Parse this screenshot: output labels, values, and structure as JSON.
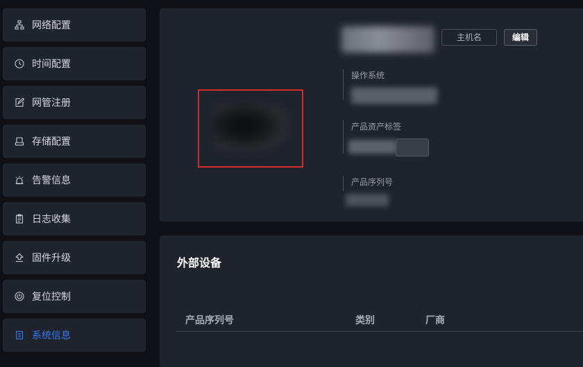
{
  "sidebar": {
    "items": [
      {
        "label": "网络配置",
        "icon": "network-icon",
        "active": false
      },
      {
        "label": "时间配置",
        "icon": "clock-icon",
        "active": false
      },
      {
        "label": "网管注册",
        "icon": "edit-icon",
        "active": false
      },
      {
        "label": "存储配置",
        "icon": "storage-icon",
        "active": false
      },
      {
        "label": "告警信息",
        "icon": "alarm-icon",
        "active": false
      },
      {
        "label": "日志收集",
        "icon": "clipboard-icon",
        "active": false
      },
      {
        "label": "固件升级",
        "icon": "upload-icon",
        "active": false
      },
      {
        "label": "复位控制",
        "icon": "power-icon",
        "active": false
      },
      {
        "label": "系统信息",
        "icon": "document-icon",
        "active": true
      }
    ]
  },
  "info": {
    "hostname_tag": "主机名",
    "edit_label": "编辑",
    "os_label": "操作系统",
    "asset_label": "产品资产标签",
    "serial_label": "产品序列号"
  },
  "external": {
    "title": "外部设备",
    "columns": [
      "产品序列号",
      "类别",
      "厂商"
    ]
  },
  "colors": {
    "accent": "#2f7bf5",
    "highlight_border": "#d42b2b",
    "panel_bg": "#1f232c",
    "page_bg": "#0f1116"
  }
}
